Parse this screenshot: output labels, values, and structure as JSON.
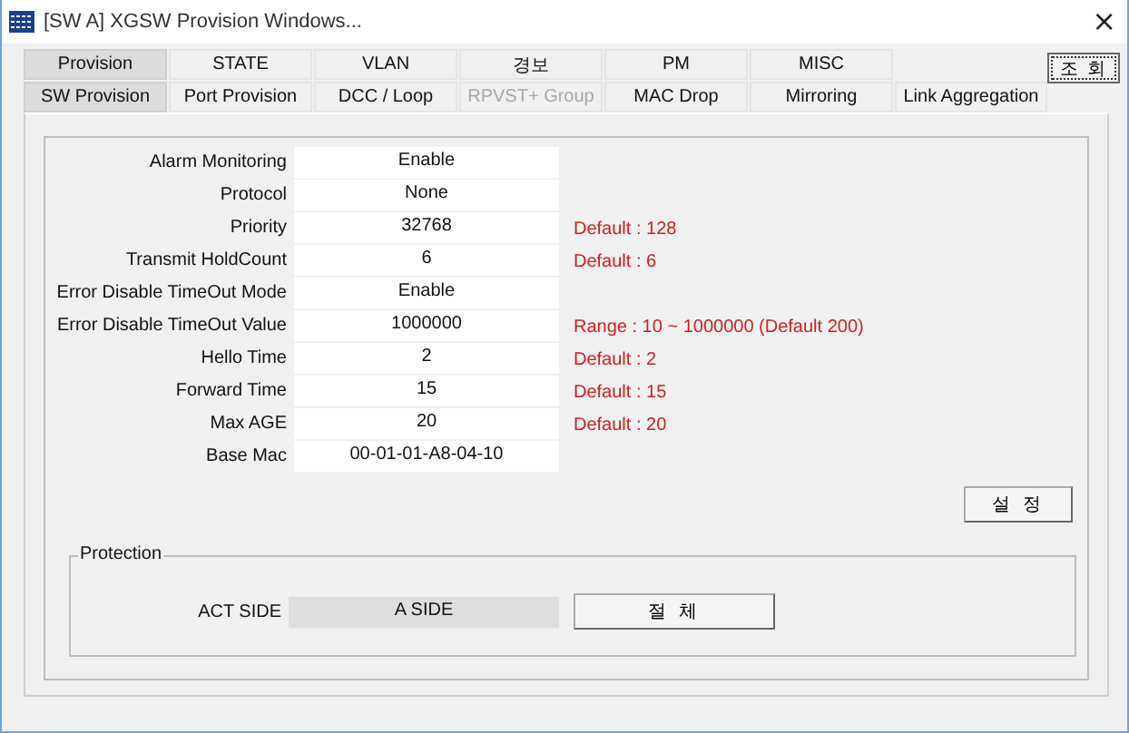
{
  "window": {
    "title": "[SW A] XGSW Provision Windows...",
    "close": "×"
  },
  "tabs_top": [
    {
      "label": "Provision",
      "selected": true,
      "disabled": false
    },
    {
      "label": "STATE",
      "selected": false,
      "disabled": false
    },
    {
      "label": "VLAN",
      "selected": false,
      "disabled": false
    },
    {
      "label": "경보",
      "selected": false,
      "disabled": false
    },
    {
      "label": "PM",
      "selected": false,
      "disabled": false
    },
    {
      "label": "MISC",
      "selected": false,
      "disabled": false
    }
  ],
  "tabs_sub": [
    {
      "label": "SW Provision",
      "selected": true,
      "disabled": false
    },
    {
      "label": "Port Provision",
      "selected": false,
      "disabled": false
    },
    {
      "label": "DCC / Loop",
      "selected": false,
      "disabled": false
    },
    {
      "label": "RPVST+ Group",
      "selected": false,
      "disabled": true
    },
    {
      "label": "MAC Drop",
      "selected": false,
      "disabled": false
    },
    {
      "label": "Mirroring",
      "selected": false,
      "disabled": false
    },
    {
      "label": "Link Aggregation",
      "selected": false,
      "disabled": false
    }
  ],
  "query_button": "조 회",
  "fields": [
    {
      "label": "Alarm Monitoring",
      "value": "Enable"
    },
    {
      "label": "Protocol",
      "value": "None"
    },
    {
      "label": "Priority",
      "value": "32768",
      "hint": "Default : 128"
    },
    {
      "label": "Transmit HoldCount",
      "value": "6",
      "hint": "Default : 6"
    },
    {
      "label": "Error Disable TimeOut Mode",
      "value": "Enable"
    },
    {
      "label": "Error Disable TimeOut Value",
      "value": "1000000",
      "hint": "Range : 10 ~ 1000000 (Default 200)"
    },
    {
      "label": "Hello Time",
      "value": "2",
      "hint": "Default : 2"
    },
    {
      "label": "Forward Time",
      "value": "15",
      "hint": "Default : 15"
    },
    {
      "label": "Max AGE",
      "value": "20",
      "hint": "Default : 20"
    },
    {
      "label": "Base Mac",
      "value": "00-01-01-A8-04-10"
    }
  ],
  "set_button": "설 정",
  "protection": {
    "title": "Protection",
    "label": "ACT SIDE",
    "value": "A SIDE",
    "button": "절 체"
  }
}
